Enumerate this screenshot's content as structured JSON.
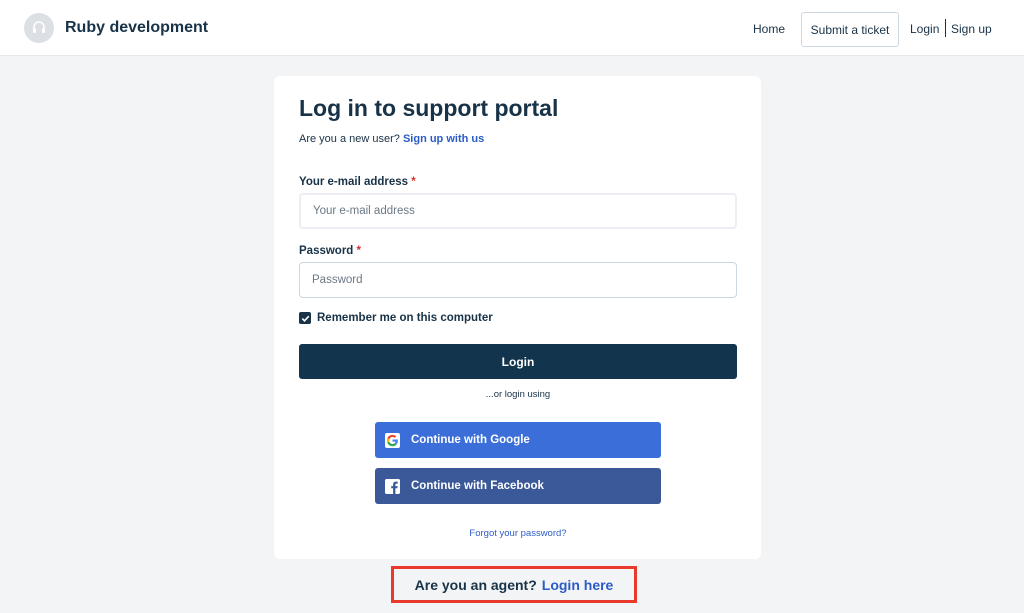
{
  "header": {
    "brand": "Ruby development",
    "nav": {
      "home": "Home",
      "submit_ticket": "Submit a ticket",
      "login": "Login",
      "signup": "Sign up"
    }
  },
  "login_card": {
    "title": "Log in to support portal",
    "new_user_prompt": "Are you a new user?",
    "signup_link": "Sign up with us",
    "email": {
      "label": "Your e-mail address",
      "required_mark": "*",
      "placeholder": "Your e-mail address",
      "value": ""
    },
    "password": {
      "label": "Password",
      "required_mark": "*",
      "placeholder": "Password",
      "value": ""
    },
    "remember_me": {
      "label": "Remember me on this computer",
      "checked": true
    },
    "login_button": "Login",
    "or_login_using": "...or login using",
    "google_button": "Continue with Google",
    "facebook_button": "Continue with Facebook",
    "forgot_password": "Forgot your password?"
  },
  "agent": {
    "prompt": "Are you an agent?",
    "link": "Login here"
  },
  "icons": {
    "logo": "headset-icon",
    "google": "google-icon",
    "facebook": "facebook-icon",
    "checkbox": "check-icon"
  },
  "colors": {
    "primary": "#12344d",
    "link": "#2c5cc5",
    "google": "#3b6ed8",
    "facebook": "#3b5998",
    "highlight": "#e8392c",
    "required": "#d72d30"
  }
}
